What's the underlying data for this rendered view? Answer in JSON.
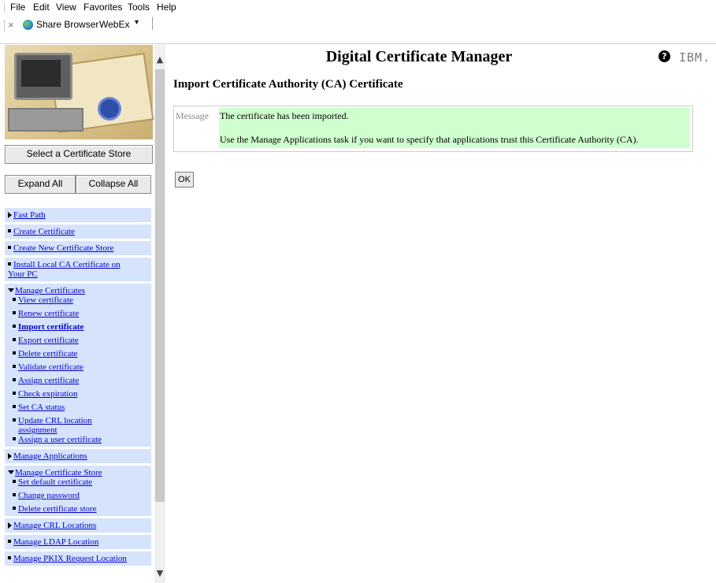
{
  "menu": {
    "items": [
      "File",
      "Edit",
      "View",
      "Favorites",
      "Tools",
      "Help"
    ]
  },
  "toolbar": {
    "close_glyph": "×",
    "share_label": "Share Browser",
    "webex_label": "WebEx",
    "dropdown_glyph": "▾"
  },
  "left": {
    "select_store_label": "Select a Certificate Store",
    "expand_label": "Expand All",
    "collapse_label": "Collapse All",
    "nav": {
      "fast_path": "Fast Path",
      "create_certificate": "Create Certificate",
      "create_new_store": "Create New Certificate Store",
      "install_local_ca_line1": "Install Local CA Certificate on",
      "install_local_ca_line2": "Your PC",
      "manage_certificates": "Manage Certificates",
      "manage_certificates_sub": [
        "View certificate",
        "Renew certificate",
        "Import certificate",
        "Export certificate",
        "Delete certificate",
        "Validate certificate",
        "Assign certificate",
        "Check expiration",
        "Set CA status",
        "Update CRL location",
        "assignment",
        "Assign a user certificate"
      ],
      "manage_applications": "Manage Applications",
      "manage_store": "Manage Certificate Store",
      "manage_store_sub": [
        "Set default certificate",
        "Change password",
        "Delete certificate store"
      ],
      "manage_crl": "Manage CRL Locations",
      "manage_ldap": "Manage LDAP Location",
      "manage_pkix": "Manage PKIX Request Location"
    }
  },
  "main": {
    "title": "Digital Certificate Manager",
    "help_glyph": "?",
    "ibm_logo": "IBM.",
    "subtitle": "Import Certificate Authority (CA) Certificate",
    "message_label": "Message",
    "message_line1": "The certificate has been imported.",
    "message_line2": "Use the Manage Applications task if you want to specify that applications trust this Certificate Authority (CA).",
    "ok_label": "OK"
  },
  "colors": {
    "nav_bg": "#d5e3fc",
    "message_bg": "#cfffcf",
    "link": "#0000cc"
  }
}
